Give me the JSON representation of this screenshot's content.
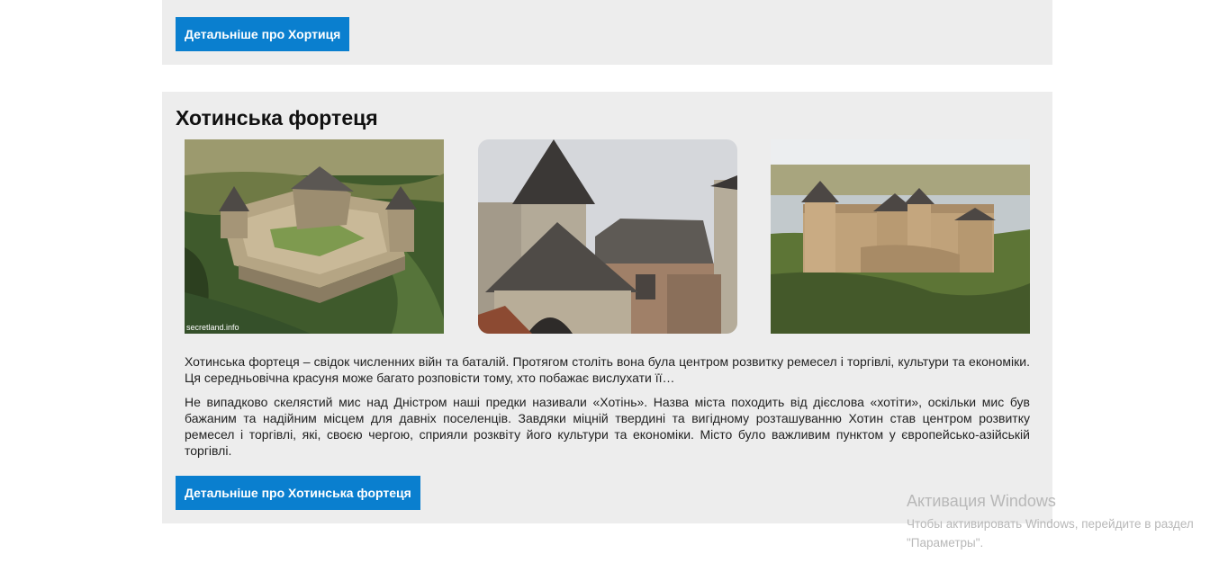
{
  "top_card": {
    "button_label": "Детальніше про Хортиця"
  },
  "main_card": {
    "title": "Хотинська фортеця",
    "images": [
      {
        "watermark": "secretland.info"
      }
    ],
    "paragraphs": [
      "Хотинська фортеця – свідок численних війн та баталій. Протягом століть вона була центром розвитку ремесел і торгівлі, культури та економіки. Ця середньовічна красуня може багато розповісти тому, хто побажає вислухати її…",
      "Не випадково скелястий мис над Дністром наші предки називали «Хотінь». Назва міста походить від дієслова «хотіти», оскільки мис був бажаним та надійним місцем для давніх поселенців. Завдяки міцній твердині та вигідному розташуванню Хотин став центром розвитку ремесел і торгівлі, які, своєю чергою, сприяли розквіту його культури та економіки. Місто було важливим пунктом у європейсько-азійській торгівлі."
    ],
    "button_label": "Детальніше про Хотинська фортеця"
  },
  "windows_activation": {
    "title": "Активация Windows",
    "text": "Чтобы активировать Windows, перейдите в раздел \"Параметры\"."
  },
  "colors": {
    "button": "#0a7fcf",
    "card_background": "#ededed",
    "page_background": "#ffffff"
  }
}
